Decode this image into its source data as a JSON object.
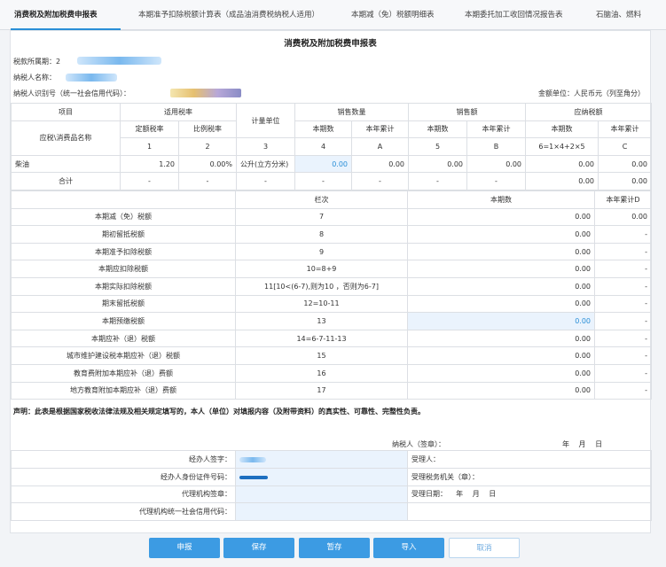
{
  "tabs": [
    {
      "label": "消费税及附加税费申报表",
      "active": true
    },
    {
      "label": "本期准予扣除税额计算表（成品油消费税纳税人适用）"
    },
    {
      "label": "本期减（免）税额明细表"
    },
    {
      "label": "本期委托加工收回情况报告表"
    },
    {
      "label": "石脑油、燃料"
    }
  ],
  "form": {
    "title": "消费税及附加税费申报表",
    "period_label": "税款所属期：",
    "period_value": "2",
    "taxpayer_name_label": "纳税人名称：",
    "taxpayer_id_label": "纳税人识别号（统一社会信用代码）：",
    "unit_label": "金额单位：人民币元（列至角分）"
  },
  "main_table": {
    "h_item": "项目",
    "h_rate": "适用税率",
    "h_unit": "计量单位",
    "h_qty": "销售数量",
    "h_amt": "销售额",
    "h_tax": "应纳税额",
    "h_fixed": "定额税率",
    "h_ratio": "比例税率",
    "h_cur": "本期数",
    "h_ytd": "本年累计",
    "h_name": "应税\\消费品名称",
    "codes": [
      "1",
      "2",
      "3",
      "4",
      "A",
      "5",
      "B",
      "6=1×4+2×5",
      "C"
    ],
    "row_name": "柴油",
    "row": [
      "1.20",
      "0.00%",
      "公升(立方分米)",
      "0.00",
      "0.00",
      "0.00",
      "0.00",
      "0.00",
      "0.00"
    ],
    "total_label": "合计",
    "total": [
      "-",
      "-",
      "-",
      "-",
      "-",
      "-",
      "-",
      "0.00",
      "0.00"
    ]
  },
  "section2": {
    "h_col": "栏次",
    "h_cur": "本期数",
    "h_ytd": "本年累计D",
    "rows": [
      {
        "label": "本期减（免）税额",
        "code": "7",
        "cur": "0.00",
        "ytd": "0.00"
      },
      {
        "label": "期初留抵税额",
        "code": "8",
        "cur": "0.00",
        "ytd": "-"
      },
      {
        "label": "本期准予扣除税额",
        "code": "9",
        "cur": "0.00",
        "ytd": "-"
      },
      {
        "label": "本期应扣除税额",
        "code": "10=8+9",
        "cur": "0.00",
        "ytd": "-"
      },
      {
        "label": "本期实际扣除税额",
        "code": "11[10<(6-7),则为10 ，否则为6-7]",
        "cur": "0.00",
        "ytd": "-"
      },
      {
        "label": "期末留抵税额",
        "code": "12=10-11",
        "cur": "0.00",
        "ytd": "-"
      },
      {
        "label": "本期预缴税额",
        "code": "13",
        "cur": "0.00",
        "ytd": "-"
      },
      {
        "label": "本期应补（退）税额",
        "code": "14=6-7-11-13",
        "cur": "0.00",
        "ytd": "-"
      },
      {
        "label": "城市维护建设税本期应补（退）税额",
        "code": "15",
        "cur": "0.00",
        "ytd": "-"
      },
      {
        "label": "教育费附加本期应补（退）费额",
        "code": "16",
        "cur": "0.00",
        "ytd": "-"
      },
      {
        "label": "地方教育附加本期应补（退）费额",
        "code": "17",
        "cur": "0.00",
        "ytd": "-"
      }
    ]
  },
  "declaration": "声明：此表是根据国家税收法律法规及相关规定填写的，本人（单位）对填报内容（及附带资料）的真实性、可靠性、完整性负责。",
  "sign": {
    "taxpayer_sign": "纳税人（签章）：",
    "date_ymd": "年　 月　 日",
    "agent_sign": "经办人签字：",
    "agent_id": "经办人身份证件号码：",
    "agency_seal": "代理机构签章：",
    "agency_code": "代理机构统一社会信用代码：",
    "receiver": "受理人：",
    "tax_office": "受理税务机关（章）：",
    "receive_date": "受理日期：",
    "receive_ymd": "年　 月　 日"
  },
  "buttons": {
    "submit": "申报",
    "save": "保存",
    "temp_save": "暂存",
    "import": "导入",
    "cancel": "取消"
  }
}
